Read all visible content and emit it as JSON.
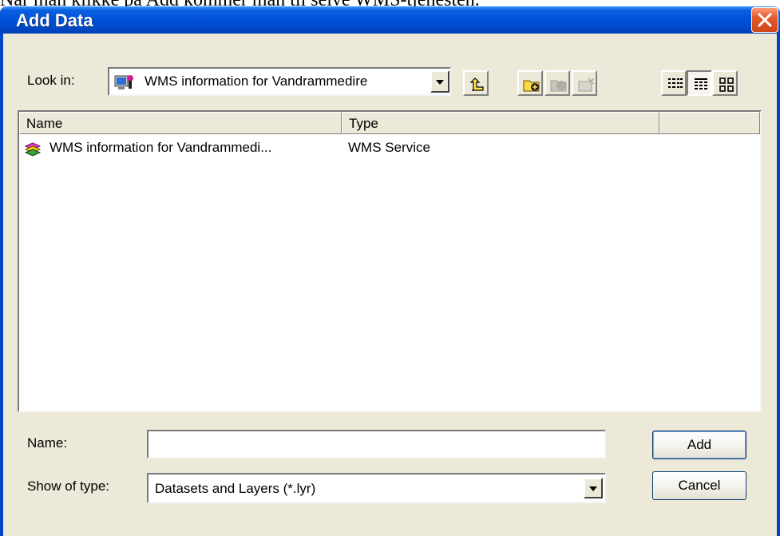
{
  "document": {
    "top_text": "Når man klikke på Add kommer man til selve WMS-tjenesten."
  },
  "window": {
    "title": "Add Data",
    "close_icon": "close-icon"
  },
  "look_in": {
    "label": "Look in:",
    "value": "WMS information for Vandrammedire",
    "icon": "wms-connection-icon"
  },
  "toolbar": {
    "buttons": [
      {
        "name": "up-one-level-icon",
        "enabled": true
      },
      {
        "name": "connect-to-folder-icon",
        "enabled": true
      },
      {
        "name": "disconnect-from-folder-icon",
        "enabled": false
      },
      {
        "name": "new-geodatabase-icon",
        "enabled": false
      },
      {
        "name": "list-view-icon",
        "enabled": true
      },
      {
        "name": "details-view-icon",
        "enabled": true,
        "pressed": true
      },
      {
        "name": "thumbnails-view-icon",
        "enabled": true
      }
    ]
  },
  "list": {
    "columns": [
      "Name",
      "Type",
      ""
    ],
    "rows": [
      {
        "name": "WMS information for Vandrammedi...",
        "type": "WMS Service",
        "icon": "wms-service-icon"
      }
    ]
  },
  "name_field": {
    "label": "Name:",
    "value": ""
  },
  "type_field": {
    "label": "Show of type:",
    "value": "Datasets and Layers (*.lyr)"
  },
  "buttons": {
    "add": "Add",
    "cancel": "Cancel"
  }
}
